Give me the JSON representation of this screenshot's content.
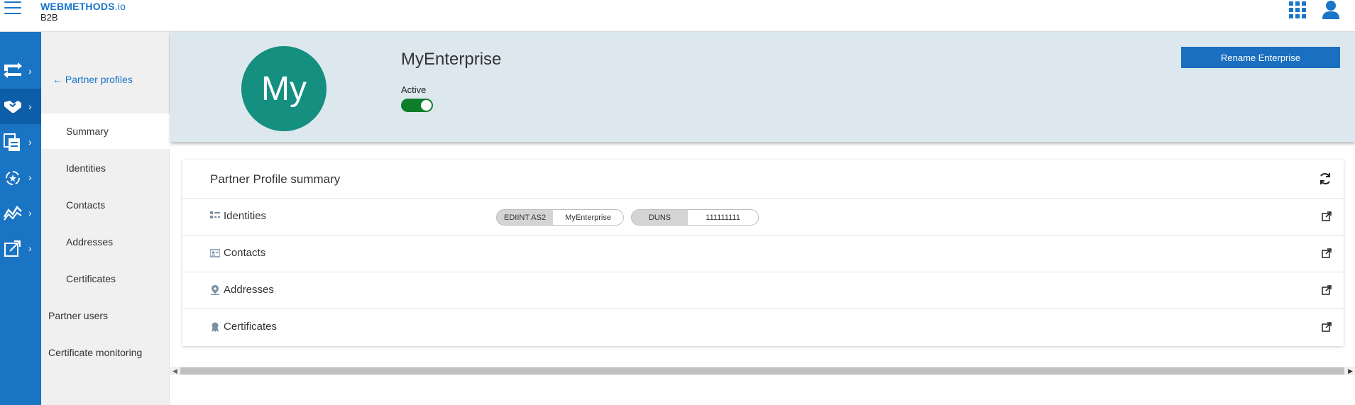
{
  "brand": {
    "title": "WEBMETHODS",
    "title_suffix": ".io",
    "subtitle": "B2B",
    "color": "#1976c9"
  },
  "rail": {
    "items": [
      {
        "icon": "integration-flow-icon"
      },
      {
        "icon": "handshake-partners-icon",
        "active": true
      },
      {
        "icon": "documents-icon"
      },
      {
        "icon": "processing-rules-icon"
      },
      {
        "icon": "monitoring-chart-icon"
      },
      {
        "icon": "external-link-admin-icon"
      }
    ],
    "chevron": "›"
  },
  "subnav": {
    "back_label": "Partner profiles",
    "back_arrow": "←",
    "items": [
      {
        "label": "Summary",
        "active": true
      },
      {
        "label": "Identities"
      },
      {
        "label": "Contacts"
      },
      {
        "label": "Addresses"
      },
      {
        "label": "Certificates"
      }
    ],
    "top_items": [
      {
        "label": "Partner users"
      },
      {
        "label": "Certificate monitoring"
      }
    ]
  },
  "header": {
    "avatar_text": "My",
    "avatar_color": "#148f80",
    "enterprise_name": "MyEnterprise",
    "status_label": "Active",
    "status_on": true,
    "rename_button": "Rename Enterprise"
  },
  "summary": {
    "title": "Partner Profile summary",
    "rows": [
      {
        "label": "Identities",
        "icon": "identities-icon"
      },
      {
        "label": "Contacts",
        "icon": "contact-card-icon"
      },
      {
        "label": "Addresses",
        "icon": "location-pin-icon"
      },
      {
        "label": "Certificates",
        "icon": "certificate-icon"
      }
    ],
    "identities": [
      {
        "type": "EDIINT AS2",
        "value": "MyEnterprise"
      },
      {
        "type": "DUNS",
        "value": "111111111"
      }
    ]
  },
  "scrollbar": {
    "left_arrow": "◀",
    "right_arrow": "▶"
  }
}
